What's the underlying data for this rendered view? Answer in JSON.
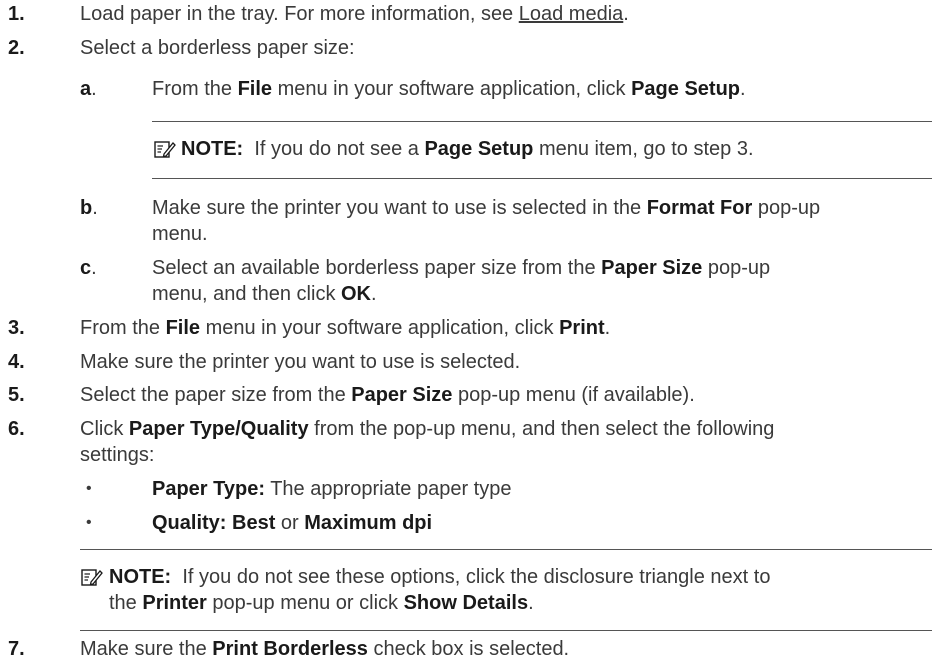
{
  "steps": {
    "s1": {
      "num": "1.",
      "text_a": "Load paper in the tray. For more information, see ",
      "link": "Load media",
      "text_b": "."
    },
    "s2": {
      "num": "2.",
      "text": "Select a borderless paper size:"
    },
    "s2a": {
      "label": "a",
      "dot": ".",
      "t1": "From the ",
      "b1": "File",
      "t2": " menu in your software application, click ",
      "b2": "Page Setup",
      "t3": "."
    },
    "note1": {
      "label": "NOTE:",
      "t1": "If you do not see a ",
      "b1": "Page Setup",
      "t2": " menu item, go to step 3."
    },
    "s2b": {
      "label": "b",
      "dot": ".",
      "t1": "Make sure the printer you want to use is selected in the ",
      "b1": "Format For",
      "t2": " pop-up",
      "line2": "menu."
    },
    "s2c": {
      "label": "c",
      "dot": ".",
      "t1": "Select an available borderless paper size from the ",
      "b1": "Paper Size",
      "t2": " pop-up",
      "line2_t1": "menu, and then click ",
      "line2_b1": "OK",
      "line2_t2": "."
    },
    "s3": {
      "num": "3.",
      "t1": "From the ",
      "b1": "File",
      "t2": " menu in your software application, click ",
      "b2": "Print",
      "t3": "."
    },
    "s4": {
      "num": "4.",
      "text": "Make sure the printer you want to use is selected."
    },
    "s5": {
      "num": "5.",
      "t1": "Select the paper size from the ",
      "b1": "Paper Size",
      "t2": " pop-up menu (if available)."
    },
    "s6": {
      "num": "6.",
      "t1": "Click ",
      "b1": "Paper Type/Quality",
      "t2": " from the pop-up menu, and then select the following",
      "line2": "settings:"
    },
    "bullet1": {
      "mark": "•",
      "b1": "Paper Type:",
      "t1": " The appropriate paper type"
    },
    "bullet2": {
      "mark": "•",
      "b1": "Quality: Best",
      "t1": " or ",
      "b2": "Maximum dpi"
    },
    "note2": {
      "label": "NOTE:",
      "t1": "If you do not see these options, click the disclosure triangle next to",
      "line2_t1": "the ",
      "line2_b1": "Printer",
      "line2_t2": " pop-up menu or click ",
      "line2_b2": "Show Details",
      "line2_t3": "."
    },
    "s7": {
      "num": "7.",
      "t1": "Make sure the ",
      "b1": "Print Borderless",
      "t2": " check box is selected."
    }
  },
  "icons": {
    "note": "note-pad-pencil-icon"
  }
}
